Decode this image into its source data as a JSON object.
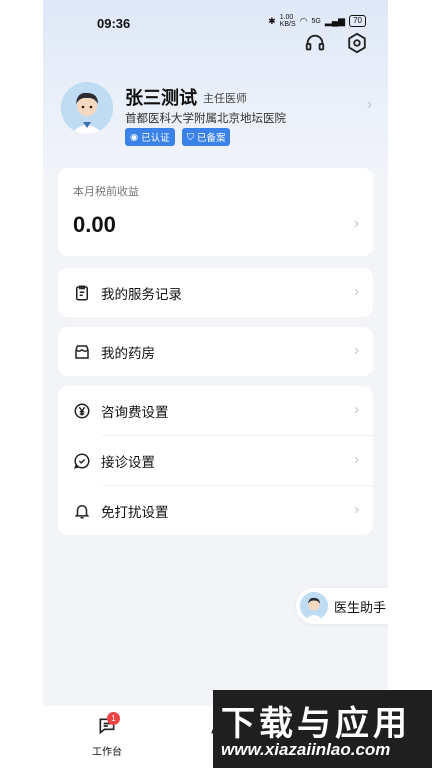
{
  "status_bar": {
    "time": "09:36",
    "net_speed": "1.00\nKB/S",
    "signal": "5G",
    "battery": "70"
  },
  "profile": {
    "name": "张三测试",
    "title": "主任医师",
    "hospital": "首都医科大学附属北京地坛医院",
    "badge_certified": "已认证",
    "badge_filed": "已备案"
  },
  "income": {
    "label": "本月税前收益",
    "value": "0.00"
  },
  "menu": {
    "service_records": "我的服务记录",
    "pharmacy": "我的药房",
    "consult_fee": "咨询费设置",
    "consult_settings": "接诊设置",
    "dnd_settings": "免打扰设置"
  },
  "assistant": {
    "label": "医生助手"
  },
  "tabbar": {
    "workbench": "工作台",
    "workbench_badge": "1"
  },
  "watermark": {
    "title": "下载与应用",
    "site": "www.xiazaiinlao.com"
  },
  "colors": {
    "accent": "#3b82e8",
    "badge_red": "#ef4444"
  }
}
